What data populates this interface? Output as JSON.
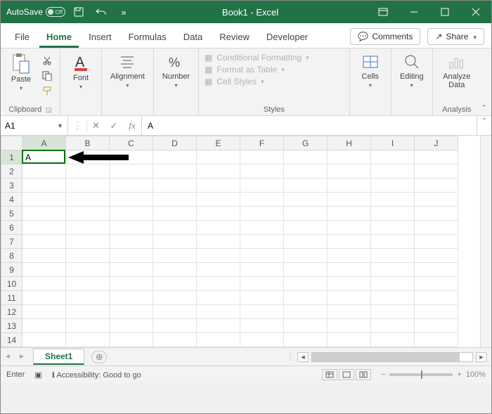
{
  "titlebar": {
    "autosave_label": "AutoSave",
    "autosave_state": "Off",
    "title": "Book1  -  Excel"
  },
  "tabs": {
    "file": "File",
    "home": "Home",
    "insert": "Insert",
    "formulas": "Formulas",
    "data": "Data",
    "review": "Review",
    "developer": "Developer",
    "comments": "Comments",
    "share": "Share"
  },
  "ribbon": {
    "clipboard": {
      "paste": "Paste",
      "label": "Clipboard"
    },
    "font": {
      "btn": "Font"
    },
    "alignment": {
      "btn": "Alignment"
    },
    "number": {
      "btn": "Number"
    },
    "styles": {
      "cond": "Conditional Formatting",
      "table": "Format as Table",
      "cell": "Cell Styles",
      "label": "Styles"
    },
    "cells": {
      "btn": "Cells"
    },
    "editing": {
      "btn": "Editing"
    },
    "analysis": {
      "btn": "Analyze Data",
      "label": "Analysis"
    }
  },
  "formulabar": {
    "namebox": "A1",
    "value": "A"
  },
  "grid": {
    "columns": [
      "A",
      "B",
      "C",
      "D",
      "E",
      "F",
      "G",
      "H",
      "I",
      "J"
    ],
    "rows": [
      "1",
      "2",
      "3",
      "4",
      "5",
      "6",
      "7",
      "8",
      "9",
      "10",
      "11",
      "12",
      "13",
      "14"
    ],
    "active_cell_value": "A"
  },
  "sheetbar": {
    "sheet1": "Sheet1"
  },
  "statusbar": {
    "mode": "Enter",
    "accessibility": "Accessibility: Good to go",
    "zoom": "100%"
  }
}
